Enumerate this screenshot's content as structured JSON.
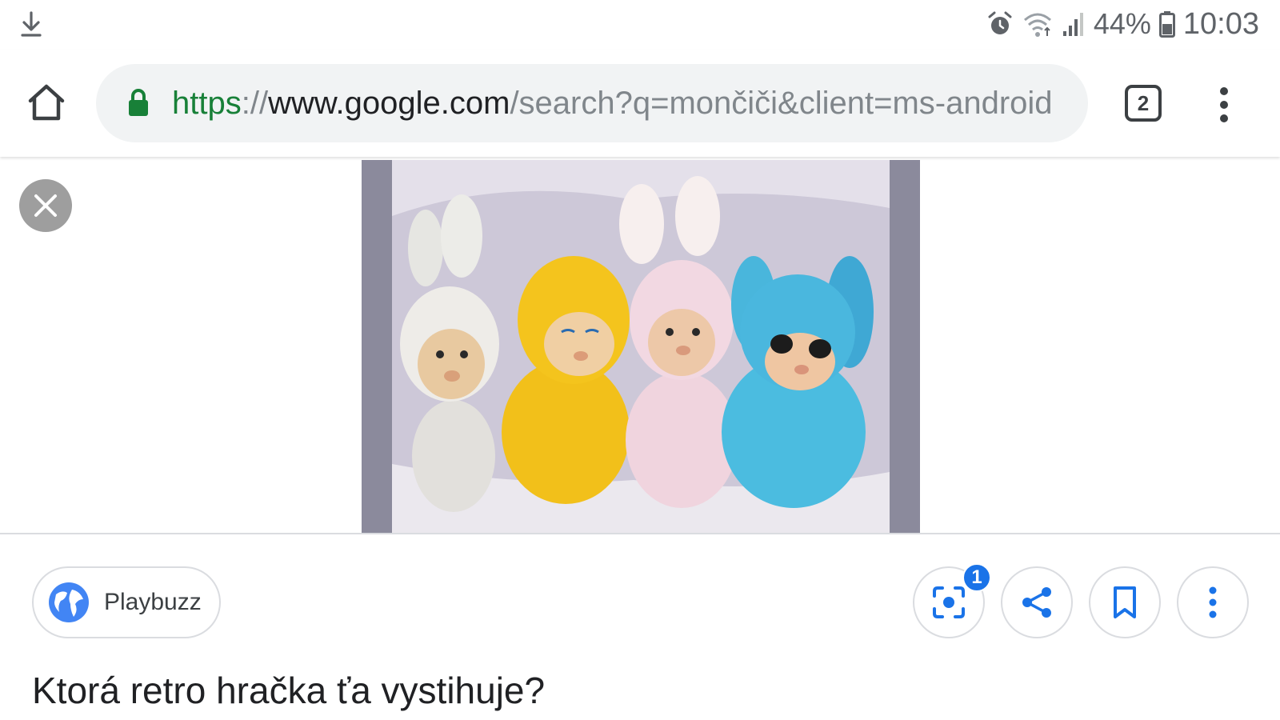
{
  "status_bar": {
    "battery": "44%",
    "time": "10:03",
    "icons": [
      "download-icon",
      "alarm-icon",
      "wifi-icon",
      "signal-icon",
      "battery-icon"
    ]
  },
  "toolbar": {
    "url_scheme": "https",
    "url_separator": "://",
    "url_host": "www.google.com",
    "url_path": "/search?q=mončiči&client=ms-android",
    "tab_count": "2",
    "icons": [
      "home-icon",
      "lock-icon",
      "more-vert-icon"
    ]
  },
  "viewer": {
    "icons": [
      "close-icon"
    ]
  },
  "result": {
    "source_name": "Playbuzz",
    "title": "Ktorá retro hračka ťa vystihuje?",
    "lens_badge": "1",
    "actions": [
      "lens-icon",
      "share-icon",
      "bookmark-icon",
      "more-vert-icon"
    ]
  },
  "colors": {
    "url_scheme": "#188038",
    "lock": "#188038",
    "accent_blue": "#1a73e8",
    "chip_border": "#dadce0"
  }
}
